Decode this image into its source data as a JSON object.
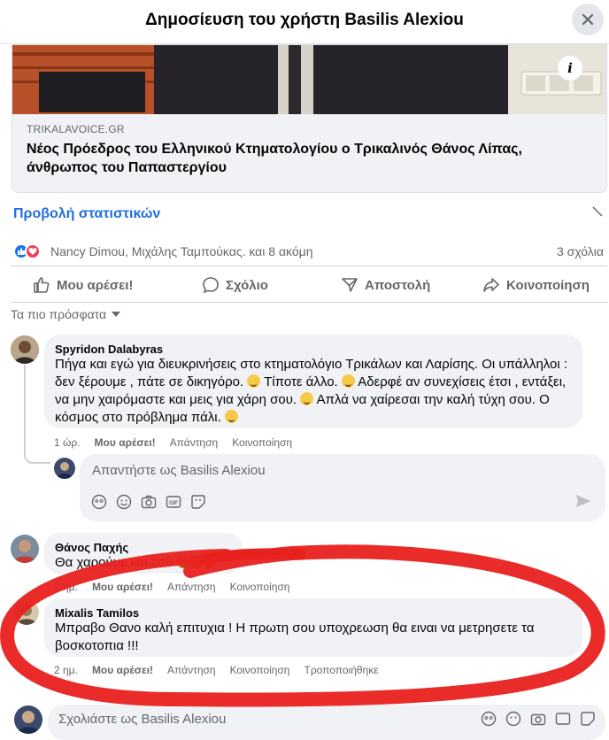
{
  "header": {
    "title": "Δημοσίευση του χρήστη Basilis Alexiou",
    "close_icon": "close-icon"
  },
  "link_card": {
    "source": "TRIKALAVOICE.GR",
    "title": "Νέος Πρόεδρος του Ελληνικού Κτηματολογίου ο Τρικαλινός Θάνος Λίπας, άνθρωπος του Παπαστεργίου",
    "info_icon": "i"
  },
  "stats_link": "Προβολή στατιστικών",
  "reactions": {
    "icons": [
      "like-icon",
      "love-icon"
    ],
    "text": "Nancy Dimou, Μιχάλης Ταμπούκας. και 8 ακόμη",
    "comments": "3 σχόλια"
  },
  "actions": {
    "like": "Μου αρέσει!",
    "comment": "Σχόλιο",
    "send": "Αποστολή",
    "share": "Κοινοποίηση"
  },
  "sort": {
    "label": "Τα πιο πρόσφατα"
  },
  "comments": [
    {
      "name": "Spyridon Dalabyras",
      "text": "Πήγα και εγώ για διευκρινήσεις στο κτηματολόγιο Τρικάλων και Λαρίσης. Οι υπάλληλοι : δεν ξέρουμε , πάτε σε δικηγόρο.",
      "text2": " Τίποτε άλλο.",
      "text3": " Αδερφέ αν συνεχίσεις έτσι , εντάξει, να μην χαιρόμαστε και μεις για χάρη σου.",
      "text4": " Απλά να χαίρεσαι την καλή τύχη σου. Ο κόσμος στο πρόβλημα πάλι.",
      "time": "1 ώρ.",
      "like": "Μου αρέσει!",
      "reply": "Απάντηση",
      "share": "Κοινοποίηση"
    },
    {
      "name": "Θάνος Παχής",
      "text": "Θα χαρούμε και εσύ",
      "time": "2 ημ.",
      "like": "Μου αρέσει!",
      "reply": "Απάντηση",
      "share": "Κοινοποίηση"
    },
    {
      "name": "Mixalis Tamilos",
      "text": "Μπραβο Θανο καλή επιτυχια ! Η πρωτη σου υποχρεωση θα ειναι να μετρησετε τα βοσκοτοπια !!!",
      "time": "2 ημ.",
      "like": "Μου αρέσει!",
      "reply": "Απάντηση",
      "share": "Κοινοποίηση",
      "edited": "Τροποποιήθηκε"
    }
  ],
  "reply_box": {
    "placeholder": "Απαντήστε ως Basilis Alexiou"
  },
  "comment_box": {
    "placeholder": "Σχολιάστε ως Basilis Alexiou"
  },
  "colors": {
    "accent": "#216fdb",
    "bubble": "#f0f2f5",
    "annotation": "#e8201e",
    "like": "#1877f2",
    "love": "#f33e58"
  }
}
